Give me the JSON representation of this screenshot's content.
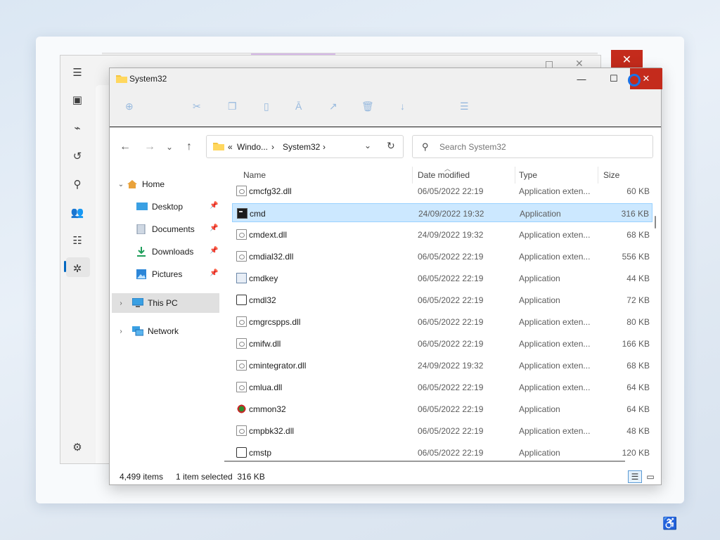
{
  "explorer": {
    "title": "System32",
    "address": {
      "prefix": "«",
      "crumb1": "Windo...",
      "crumb2": "System32"
    },
    "search_placeholder": "Search System32",
    "nav": {
      "home": "Home",
      "desktop": "Desktop",
      "documents": "Documents",
      "downloads": "Downloads",
      "pictures": "Pictures",
      "this_pc": "This PC",
      "network": "Network"
    },
    "columns": {
      "name": "Name",
      "date": "Date modified",
      "type": "Type",
      "size": "Size"
    },
    "files": [
      {
        "name": "cmcfg32.dll",
        "date": "06/05/2022 22:19",
        "type": "Application exten...",
        "size": "60 KB",
        "icon": "dll-file-icon"
      },
      {
        "name": "cmd",
        "date": "24/09/2022 19:32",
        "type": "Application",
        "size": "316 KB",
        "icon": "console-app-icon"
      },
      {
        "name": "cmdext.dll",
        "date": "24/09/2022 19:32",
        "type": "Application exten...",
        "size": "68 KB",
        "icon": "dll-file-icon"
      },
      {
        "name": "cmdial32.dll",
        "date": "06/05/2022 22:19",
        "type": "Application exten...",
        "size": "556 KB",
        "icon": "dll-file-icon"
      },
      {
        "name": "cmdkey",
        "date": "06/05/2022 22:19",
        "type": "Application",
        "size": "44 KB",
        "icon": "app-window-icon"
      },
      {
        "name": "cmdl32",
        "date": "06/05/2022 22:19",
        "type": "Application",
        "size": "72 KB",
        "icon": "gear-app-icon"
      },
      {
        "name": "cmgrcspps.dll",
        "date": "06/05/2022 22:19",
        "type": "Application exten...",
        "size": "80 KB",
        "icon": "dll-file-icon"
      },
      {
        "name": "cmifw.dll",
        "date": "06/05/2022 22:19",
        "type": "Application exten...",
        "size": "166 KB",
        "icon": "dll-file-icon"
      },
      {
        "name": "cmintegrator.dll",
        "date": "24/09/2022 19:32",
        "type": "Application exten...",
        "size": "68 KB",
        "icon": "dll-file-icon"
      },
      {
        "name": "cmlua.dll",
        "date": "06/05/2022 22:19",
        "type": "Application exten...",
        "size": "64 KB",
        "icon": "dll-file-icon"
      },
      {
        "name": "cmmon32",
        "date": "06/05/2022 22:19",
        "type": "Application",
        "size": "64 KB",
        "icon": "network-monitor-icon"
      },
      {
        "name": "cmpbk32.dll",
        "date": "06/05/2022 22:19",
        "type": "Application exten...",
        "size": "48 KB",
        "icon": "dll-file-icon"
      },
      {
        "name": "cmstp",
        "date": "06/05/2022 22:19",
        "type": "Application",
        "size": "120 KB",
        "icon": "gear-app-icon"
      }
    ],
    "selected_index": 1,
    "status": {
      "items": "4,499 items",
      "selected": "1 item selected  316 KB"
    }
  }
}
